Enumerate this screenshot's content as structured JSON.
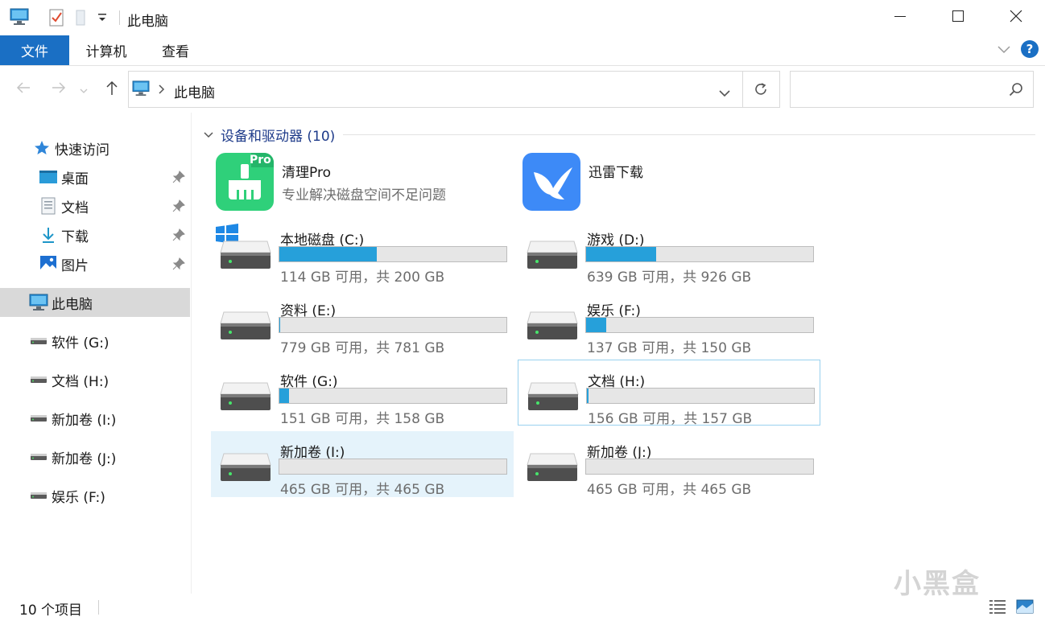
{
  "window": {
    "title": "此电脑",
    "controls": {
      "minimize": "minimize-icon",
      "maximize": "maximize-icon",
      "close": "close-icon"
    }
  },
  "ribbon": {
    "tabs": [
      {
        "label": "文件",
        "active": true
      },
      {
        "label": "计算机"
      },
      {
        "label": "查看"
      }
    ]
  },
  "address": {
    "path": "此电脑",
    "search_placeholder": ""
  },
  "sidebar": {
    "quick_access": "快速访问",
    "pinned": [
      {
        "label": "桌面",
        "icon": "desktop-icon"
      },
      {
        "label": "文档",
        "icon": "document-icon"
      },
      {
        "label": "下载",
        "icon": "download-icon"
      },
      {
        "label": "图片",
        "icon": "picture-icon"
      }
    ],
    "this_pc": "此电脑",
    "drives": [
      {
        "label": "软件 (G:)"
      },
      {
        "label": "文档 (H:)"
      },
      {
        "label": "新加卷 (I:)"
      },
      {
        "label": "新加卷 (J:)"
      },
      {
        "label": "娱乐 (F:)"
      }
    ]
  },
  "group": {
    "title": "设备和驱动器 (10)"
  },
  "apps": [
    {
      "name": "清理Pro",
      "desc": "专业解决磁盘空间不足问题",
      "badge": "Pro"
    },
    {
      "name": "迅雷下载",
      "desc": ""
    }
  ],
  "drives": [
    {
      "name": "本地磁盘 (C:)",
      "caption": "114 GB 可用，共 200 GB",
      "used_fraction": 0.43,
      "system": true
    },
    {
      "name": "游戏 (D:)",
      "caption": "639 GB 可用，共 926 GB",
      "used_fraction": 0.31
    },
    {
      "name": "资料 (E:)",
      "caption": "779 GB 可用，共 781 GB",
      "used_fraction": 0.003
    },
    {
      "name": "娱乐 (F:)",
      "caption": "137 GB 可用，共 150 GB",
      "used_fraction": 0.087
    },
    {
      "name": "软件 (G:)",
      "caption": "151 GB 可用，共 158 GB",
      "used_fraction": 0.044
    },
    {
      "name": "文档 (H:)",
      "caption": "156 GB 可用，共 157 GB",
      "used_fraction": 0.006
    },
    {
      "name": "新加卷 (I:)",
      "caption": "465 GB 可用，共 465 GB",
      "used_fraction": 0.0
    },
    {
      "name": "新加卷 (J:)",
      "caption": "465 GB 可用，共 465 GB",
      "used_fraction": 0.0
    }
  ],
  "status": {
    "item_count": "10 个项目"
  },
  "watermark": "小黑盒",
  "colors": {
    "accent": "#1a6fc4",
    "bar_fill": "#26a0da",
    "hover": "#e5f3fb",
    "group_title": "#1e3b8a"
  }
}
